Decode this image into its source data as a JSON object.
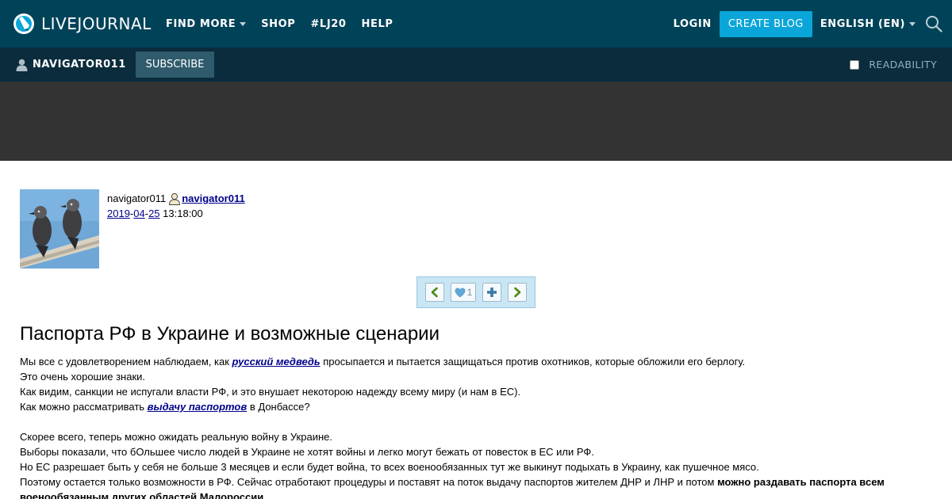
{
  "header": {
    "logo_text": "LIVEJOURNAL",
    "nav": [
      {
        "label": "FIND MORE",
        "dropdown": true
      },
      {
        "label": "SHOP"
      },
      {
        "label": "#LJ20"
      },
      {
        "label": "HELP"
      }
    ],
    "login_label": "LOGIN",
    "create_blog_label": "CREATE BLOG",
    "language_label": "ENGLISH (EN)",
    "search_icon": "search-icon"
  },
  "userbar": {
    "username": "NAVIGATOR011",
    "subscribe_label": "SUBSCRIBE",
    "readability_label": "READABILITY",
    "readability_checked": false
  },
  "post": {
    "author_plain": "navigator011",
    "author_link": "navigator011",
    "date_year": "2019",
    "date_sep1": "-",
    "date_month": "04",
    "date_sep2": "-",
    "date_day": "25",
    "time": " 13:18:00",
    "controls": {
      "like_count": "1",
      "icons": [
        "prev-entry-icon",
        "heart-icon",
        "add-icon",
        "next-entry-icon"
      ]
    },
    "title": "Паспорта РФ в Украине и возможные сценарии",
    "p1_before": "Мы все с удовлетворением наблюдаем, как ",
    "p1_link": "русский медведь",
    "p1_after": " просыпается и пытается защищаться против охотников, которые обложили его берлогу.",
    "p2": "Это очень хорошие знаки.",
    "p3": "Как видим, санкции не испугали власти РФ, и это внушает некоторою надежду всему миру (и нам в ЕС).",
    "p4_before": "Как можно рассматривать ",
    "p4_link": "выдачу паспортов",
    "p4_after": " в Донбассе?",
    "p5": "Скорее всего, теперь можно ожидать реальную войну в Украине.",
    "p6": "Выборы показали, что бОльшее число людей в Украине не хотят войны и легко могут бежать от повесток в ЕС или РФ.",
    "p7": "Но ЕС разрешает быть у себя не больше 3 месяцев и если будет война, то всех военообязанных тут же выкинут подыхать в Украину, как пушечное мясо.",
    "p8_before": "Поэтому остается только возможности в РФ. Сейчас отработают процедуры и поставят на поток выдачу паспортов жителем ДНР и ЛНР и потом ",
    "p8_bold": "можно раздавать паспорта всем военообязанным других областей Малороссии."
  },
  "colors": {
    "topbar": "#004359",
    "userbar": "#0a2c3c",
    "create_blog": "#0aa5d9",
    "subscribe": "#2f5b6c",
    "banner": "#333333",
    "link": "#00008b"
  }
}
